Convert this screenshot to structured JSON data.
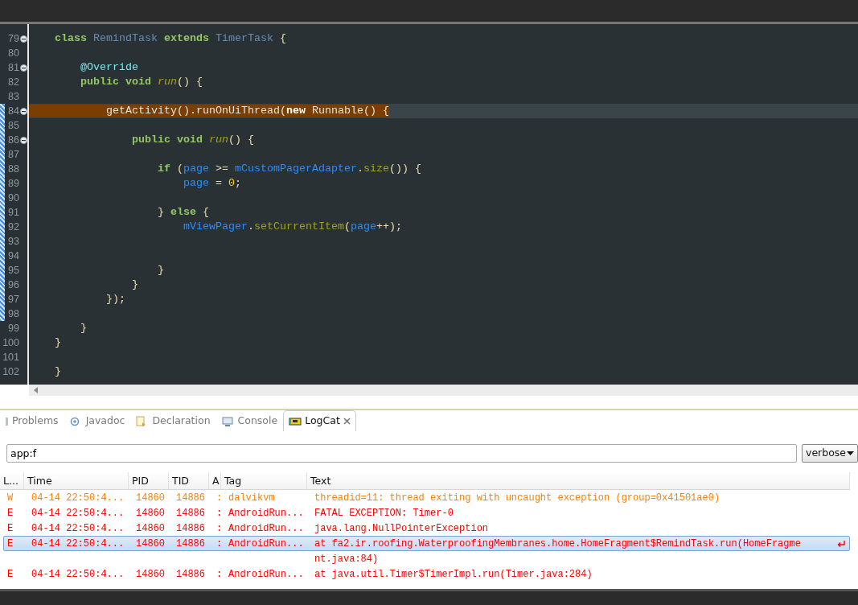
{
  "editor": {
    "lines": [
      {
        "number": "79",
        "foldable": true,
        "current": false,
        "tokens": [
          {
            "t": "    class",
            "kind": "keyword"
          },
          {
            "t": " RemindTask ",
            "kind": "type"
          },
          {
            "t": "extends",
            "kind": "keyword"
          },
          {
            "t": " TimerTask",
            "kind": "type"
          },
          {
            "t": " {",
            "kind": "punct"
          }
        ]
      },
      {
        "number": "80",
        "foldable": false,
        "current": false
      },
      {
        "number": "81",
        "foldable": true,
        "current": false,
        "tokens": [
          {
            "t": "        @Override",
            "kind": "annotation"
          }
        ]
      },
      {
        "number": "82",
        "foldable": false,
        "current": false,
        "tokens": [
          {
            "t": "        public void ",
            "kind": "keyword"
          },
          {
            "t": "run",
            "kind": "method"
          },
          {
            "t": "() {",
            "kind": "punct"
          }
        ]
      },
      {
        "number": "83",
        "foldable": false,
        "current": false
      },
      {
        "number": "84",
        "foldable": true,
        "current": true,
        "tokens": [
          {
            "t": "            getActivity().runOnUiThread(",
            "kind": "plain"
          },
          {
            "t": "new",
            "kind": "bold"
          },
          {
            "t": " Runnable() {",
            "kind": "plain"
          }
        ]
      },
      {
        "number": "85",
        "foldable": false,
        "current": false
      },
      {
        "number": "86",
        "foldable": true,
        "current": false,
        "tokens": [
          {
            "t": "                public void ",
            "kind": "keyword"
          },
          {
            "t": "run",
            "kind": "method"
          },
          {
            "t": "() {",
            "kind": "punct"
          }
        ]
      },
      {
        "number": "87",
        "foldable": false,
        "current": false
      },
      {
        "number": "88",
        "foldable": false,
        "current": false,
        "tokens": [
          {
            "t": "                    if",
            "kind": "keyword"
          },
          {
            "t": " (",
            "kind": "punct"
          },
          {
            "t": "page",
            "kind": "field"
          },
          {
            "t": " >= ",
            "kind": "punct"
          },
          {
            "t": "mCustomPagerAdapter",
            "kind": "field"
          },
          {
            "t": ".",
            "kind": "punct"
          },
          {
            "t": "size",
            "kind": "call"
          },
          {
            "t": "()) {",
            "kind": "punct"
          }
        ]
      },
      {
        "number": "89",
        "foldable": false,
        "current": false,
        "tokens": [
          {
            "t": "                        page",
            "kind": "field"
          },
          {
            "t": " = ",
            "kind": "punct"
          },
          {
            "t": "0",
            "kind": "number"
          },
          {
            "t": ";",
            "kind": "punct"
          }
        ]
      },
      {
        "number": "90",
        "foldable": false,
        "current": false
      },
      {
        "number": "91",
        "foldable": false,
        "current": false,
        "tokens": [
          {
            "t": "                    } ",
            "kind": "punct"
          },
          {
            "t": "else",
            "kind": "keyword"
          },
          {
            "t": " {",
            "kind": "punct"
          }
        ]
      },
      {
        "number": "92",
        "foldable": false,
        "current": false,
        "tokens": [
          {
            "t": "                        mViewPager",
            "kind": "field"
          },
          {
            "t": ".",
            "kind": "punct"
          },
          {
            "t": "setCurrentItem",
            "kind": "call"
          },
          {
            "t": "(",
            "kind": "punct"
          },
          {
            "t": "page",
            "kind": "field"
          },
          {
            "t": "++);",
            "kind": "punct"
          }
        ]
      },
      {
        "number": "93",
        "foldable": false,
        "current": false
      },
      {
        "number": "94",
        "foldable": false,
        "current": false
      },
      {
        "number": "95",
        "foldable": false,
        "current": false,
        "tokens": [
          {
            "t": "                    }",
            "kind": "punct"
          }
        ]
      },
      {
        "number": "96",
        "foldable": false,
        "current": false,
        "tokens": [
          {
            "t": "                }",
            "kind": "punct"
          }
        ]
      },
      {
        "number": "97",
        "foldable": false,
        "current": false,
        "tokens": [
          {
            "t": "            });",
            "kind": "punct"
          }
        ]
      },
      {
        "number": "98",
        "foldable": false,
        "current": false
      },
      {
        "number": "99",
        "foldable": false,
        "current": false,
        "tokens": [
          {
            "t": "        }",
            "kind": "punct"
          }
        ]
      },
      {
        "number": "100",
        "foldable": false,
        "current": false,
        "tokens": [
          {
            "t": "    }",
            "kind": "punct"
          }
        ]
      },
      {
        "number": "101",
        "foldable": false,
        "current": false
      },
      {
        "number": "102",
        "foldable": false,
        "current": false,
        "tokens": [
          {
            "t": "    }",
            "kind": "punct"
          }
        ]
      }
    ]
  },
  "tabs": [
    {
      "label": "Problems",
      "selected": false
    },
    {
      "label": "Javadoc",
      "selected": false
    },
    {
      "label": "Declaration",
      "selected": false
    },
    {
      "label": "Console",
      "selected": false
    },
    {
      "label": "LogCat",
      "selected": true
    }
  ],
  "filter": {
    "value": "app:f"
  },
  "level_select": {
    "value": "verbose"
  },
  "table": {
    "columns": [
      "L...",
      "Time",
      "PID",
      "TID",
      "A",
      "Tag",
      "Text"
    ],
    "rows": [
      {
        "cells": [
          "W",
          "04-14 22:50:4...",
          "14860",
          "14886",
          ":",
          "dalvikvm",
          "threadid=11: thread exiting with uncaught exception (group=0x41501ae0)"
        ],
        "color": "#ff8000",
        "selected": false
      },
      {
        "cells": [
          "E",
          "04-14 22:50:4...",
          "14860",
          "14886",
          ":",
          "AndroidRun...",
          "FATAL EXCEPTION: Timer-0"
        ],
        "color": "#ff0000",
        "selected": false
      },
      {
        "cells": [
          "E",
          "04-14 22:50:4...",
          "14860",
          "14886",
          ":",
          "AndroidRun...",
          "java.lang.NullPointerException"
        ],
        "color": "#ff0000",
        "selected": false
      },
      {
        "cells": [
          "E",
          "04-14 22:50:4...",
          "14860",
          "14886",
          ":",
          "AndroidRun...",
          "at fa2.ir.roofing.WaterproofingMembranes.home.HomeFragment$RemindTask.run(HomeFragme"
        ],
        "continuation": "nt.java:84)",
        "color": "#ff0000",
        "selected": true
      },
      {
        "cells": [
          "E",
          "04-14 22:50:4...",
          "14860",
          "14886",
          ":",
          "AndroidRun...",
          "at java.util.Timer$TimerImpl.run(Timer.java:284)"
        ],
        "color": "#ff0000",
        "selected": false
      }
    ]
  }
}
